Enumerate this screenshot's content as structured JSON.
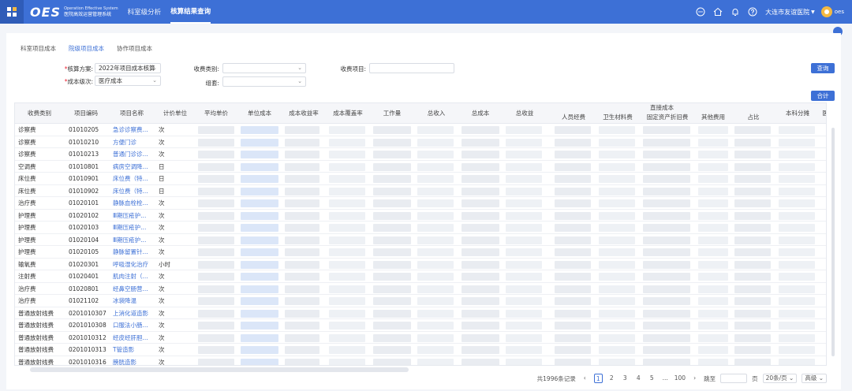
{
  "app": {
    "logo_mark": "OES",
    "logo_en": "Operation Effective System",
    "logo_cn": "医院高效运营管理系统"
  },
  "nav": [
    "科室级分析",
    "核算结果查询"
  ],
  "topright": {
    "hospital": "大连市友谊医院",
    "user": "oes"
  },
  "icons": [
    "chat-icon",
    "home-icon",
    "bell-icon",
    "help-icon"
  ],
  "tabs": [
    "科室项目成本",
    "院级项目成本",
    "协作项目成本"
  ],
  "filters": {
    "scheme_label": "核算方案:",
    "scheme_value": "2022年项目成本核算",
    "category_label": "收费类别:",
    "category_value": "",
    "item_label": "收费项目:",
    "item_value": "",
    "level_label": "成本级次:",
    "level_value": "医疗成本",
    "group_label": "组套:",
    "group_value": "",
    "query_button": "查询",
    "total_button": "合计"
  },
  "table": {
    "headers": [
      "收费类别",
      "项目编码",
      "项目名称",
      "计价单位",
      "平均单价",
      "单位成本",
      "成本收益率",
      "成本覆盖率",
      "工作量",
      "总收入",
      "总成本",
      "总收益"
    ],
    "group_header": "直接成本",
    "sub_headers": [
      "人员经费",
      "卫生材料费",
      "固定资产折旧费",
      "其他费用",
      "占比",
      "本科分摊",
      "医"
    ],
    "rows": [
      [
        "诊察费",
        "01010205",
        "急诊诊察费...",
        "次"
      ],
      [
        "诊察费",
        "01010210",
        "方便门诊",
        "次"
      ],
      [
        "诊察费",
        "01010213",
        "普通门诊诊...",
        "次"
      ],
      [
        "空调费",
        "01010801",
        "病房空调降...",
        "日"
      ],
      [
        "床位费",
        "01010901",
        "床位费（特...",
        "日"
      ],
      [
        "床位费",
        "01010902",
        "床位费（特...",
        "日"
      ],
      [
        "治疗费",
        "01020101",
        "静脉血栓栓...",
        "次"
      ],
      [
        "护理费",
        "01020102",
        "Ⅲ期压疮护...",
        "次"
      ],
      [
        "护理费",
        "01020103",
        "Ⅲ期压疮护...",
        "次"
      ],
      [
        "护理费",
        "01020104",
        "Ⅲ期压疮护...",
        "次"
      ],
      [
        "护理费",
        "01020105",
        "静脉留置针...",
        "次"
      ],
      [
        "输氧费",
        "01020301",
        "呼吸湿化治疗",
        "小时"
      ],
      [
        "注射费",
        "01020401",
        "肌肉注射（...",
        "次"
      ],
      [
        "治疗费",
        "01020801",
        "经鼻空肠营...",
        "次"
      ],
      [
        "治疗费",
        "01021102",
        "冰袋降温",
        "次"
      ],
      [
        "普通放射线费",
        "0201010307",
        "上消化道造影",
        "次"
      ],
      [
        "普通放射线费",
        "0201010308",
        "口服法小肠...",
        "次"
      ],
      [
        "普通放射线费",
        "0201010312",
        "经皮经肝胆...",
        "次"
      ],
      [
        "普通放射线费",
        "0201010313",
        "T管造影",
        "次"
      ],
      [
        "普通放射线费",
        "0201010316",
        "膀胱造影",
        "次"
      ]
    ]
  },
  "pager": {
    "total": "共1996条记录",
    "pages": [
      "1",
      "2",
      "3",
      "4",
      "5",
      "...",
      "100"
    ],
    "jump_label": "跳至",
    "page_unit": "页",
    "page_size": "20条/页",
    "advanced": "高级"
  }
}
